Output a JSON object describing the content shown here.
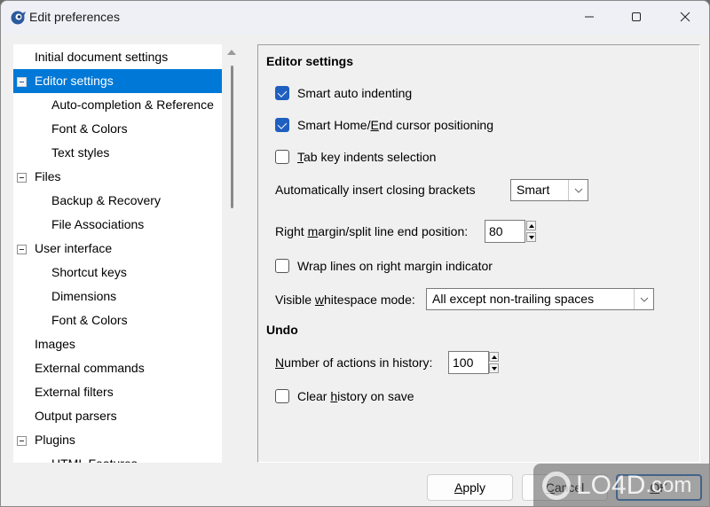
{
  "window": {
    "title": "Edit preferences",
    "icon": "app-logo-icon",
    "controls": {
      "minimize": "minimize-icon",
      "maximize": "maximize-icon",
      "close": "close-icon"
    }
  },
  "tree": {
    "items": [
      {
        "label": "Initial document settings",
        "level": 0,
        "expander": false,
        "selected": false
      },
      {
        "label": "Editor settings",
        "level": 0,
        "expander": true,
        "selected": true
      },
      {
        "label": "Auto-completion & Reference",
        "level": 1,
        "expander": false,
        "selected": false
      },
      {
        "label": "Font & Colors",
        "level": 1,
        "expander": false,
        "selected": false
      },
      {
        "label": "Text styles",
        "level": 1,
        "expander": false,
        "selected": false
      },
      {
        "label": "Files",
        "level": 0,
        "expander": true,
        "selected": false
      },
      {
        "label": "Backup & Recovery",
        "level": 1,
        "expander": false,
        "selected": false
      },
      {
        "label": "File Associations",
        "level": 1,
        "expander": false,
        "selected": false
      },
      {
        "label": "User interface",
        "level": 0,
        "expander": true,
        "selected": false
      },
      {
        "label": "Shortcut keys",
        "level": 1,
        "expander": false,
        "selected": false
      },
      {
        "label": "Dimensions",
        "level": 1,
        "expander": false,
        "selected": false
      },
      {
        "label": "Font & Colors",
        "level": 1,
        "expander": false,
        "selected": false
      },
      {
        "label": "Images",
        "level": 0,
        "expander": false,
        "selected": false
      },
      {
        "label": "External commands",
        "level": 0,
        "expander": false,
        "selected": false
      },
      {
        "label": "External filters",
        "level": 0,
        "expander": false,
        "selected": false
      },
      {
        "label": "Output parsers",
        "level": 0,
        "expander": false,
        "selected": false
      },
      {
        "label": "Plugins",
        "level": 0,
        "expander": true,
        "selected": false
      },
      {
        "label": "HTML Features",
        "level": 1,
        "expander": false,
        "selected": false
      }
    ]
  },
  "editor": {
    "section_title": "Editor settings",
    "smart_auto_indent": {
      "label": "Smart auto indenting",
      "checked": true
    },
    "smart_home_end": {
      "label_pre": "Smart Home/",
      "label_u": "E",
      "label_post": "nd cursor positioning",
      "checked": true
    },
    "tab_indents": {
      "label_u": "T",
      "label_post": "ab key indents selection",
      "checked": false
    },
    "closing_brackets": {
      "label": "Automatically insert closing brackets",
      "value": "Smart"
    },
    "right_margin": {
      "label_pre": "Right ",
      "label_u": "m",
      "label_post": "argin/split line end position:",
      "value": "80"
    },
    "wrap_lines": {
      "label": "Wrap lines on right margin indicator",
      "checked": false
    },
    "whitespace_mode": {
      "label_pre": "Visible ",
      "label_u": "w",
      "label_post": "hitespace mode:",
      "value": "All except non-trailing spaces"
    }
  },
  "undo": {
    "section_title": "Undo",
    "history_count": {
      "label_u": "N",
      "label_post": "umber of actions in history:",
      "value": "100"
    },
    "clear_on_save": {
      "label_pre": "Clear ",
      "label_u": "h",
      "label_post": "istory on save",
      "checked": false
    }
  },
  "buttons": {
    "apply": {
      "label_u": "A",
      "label_post": "pply"
    },
    "cancel": {
      "label_u": "C",
      "label_post": "ancel"
    },
    "ok": {
      "label_u": "O",
      "label_post": "K"
    }
  },
  "watermark": {
    "text": "LO4D",
    "suffix": ".com"
  },
  "colors": {
    "accent": "#0078d7",
    "checkbox": "#1f5fbf",
    "default_button_border": "#2a6fc4"
  }
}
